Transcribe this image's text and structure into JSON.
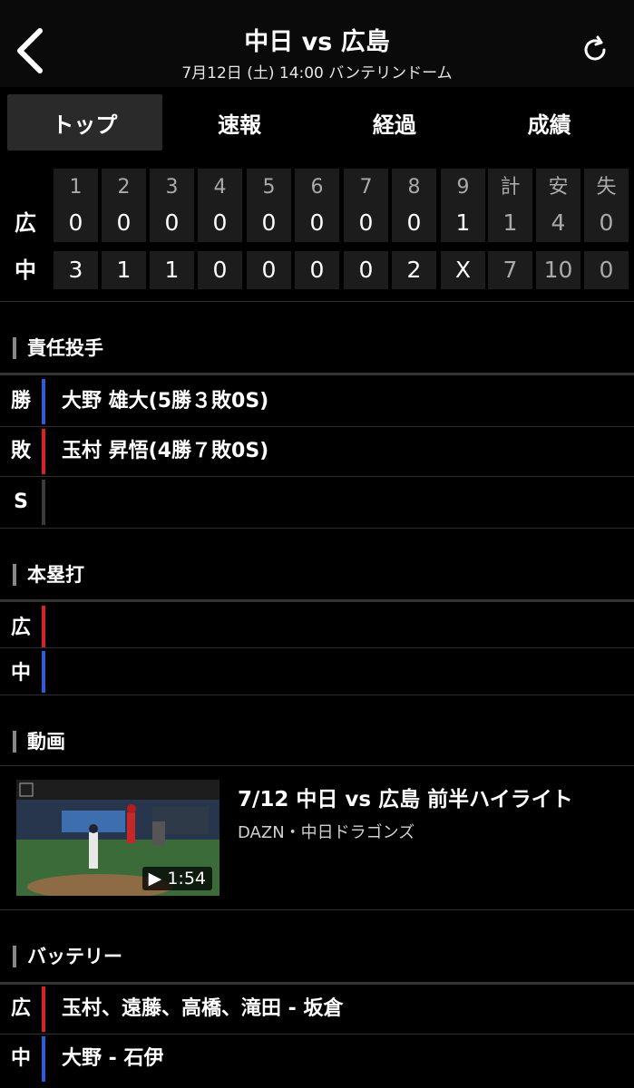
{
  "header": {
    "title": "中日 vs 広島",
    "subtitle": "7月12日 (土) 14:00 バンテリンドーム",
    "back_icon": "chevron-left-icon",
    "reload_icon": "reload-icon"
  },
  "tabs": [
    {
      "label": "トップ",
      "active": true
    },
    {
      "label": "速報",
      "active": false
    },
    {
      "label": "経過",
      "active": false
    },
    {
      "label": "成績",
      "active": false
    }
  ],
  "scoreboard": {
    "headers": [
      "1",
      "2",
      "3",
      "4",
      "5",
      "6",
      "7",
      "8",
      "9",
      "計",
      "安",
      "失"
    ],
    "rows": [
      {
        "team": "広",
        "cells": [
          "0",
          "0",
          "0",
          "0",
          "0",
          "0",
          "0",
          "0",
          "1",
          "1",
          "4",
          "0"
        ]
      },
      {
        "team": "中",
        "cells": [
          "3",
          "1",
          "1",
          "0",
          "0",
          "0",
          "0",
          "2",
          "X",
          "7",
          "10",
          "0"
        ]
      }
    ]
  },
  "pitchers": {
    "title": "責任投手",
    "rows": [
      {
        "label": "勝",
        "text": "大野 雄大(5勝３敗0S)",
        "color": "blue"
      },
      {
        "label": "敗",
        "text": "玉村 昇悟(4勝７敗0S)",
        "color": "red"
      },
      {
        "label": "S",
        "text": "",
        "color": "gray"
      }
    ]
  },
  "homeruns": {
    "title": "本塁打",
    "rows": [
      {
        "label": "広",
        "text": "",
        "color": "red"
      },
      {
        "label": "中",
        "text": "",
        "color": "blue"
      }
    ]
  },
  "video": {
    "section_title": "動画",
    "title": "7/12 中日 vs 広島 前半ハイライト",
    "source": "DAZN・中日ドラゴンズ",
    "duration": "▶ 1:54"
  },
  "battery": {
    "title": "バッテリー",
    "rows": [
      {
        "label": "広",
        "text": "玉村、遠藤、高橋、滝田 - 坂倉",
        "color": "red"
      },
      {
        "label": "中",
        "text": "大野 - 石伊",
        "color": "blue"
      }
    ]
  },
  "colors": {
    "blue": "#2e5bd8",
    "red": "#d3232c",
    "gray": "#3a3a3a"
  }
}
